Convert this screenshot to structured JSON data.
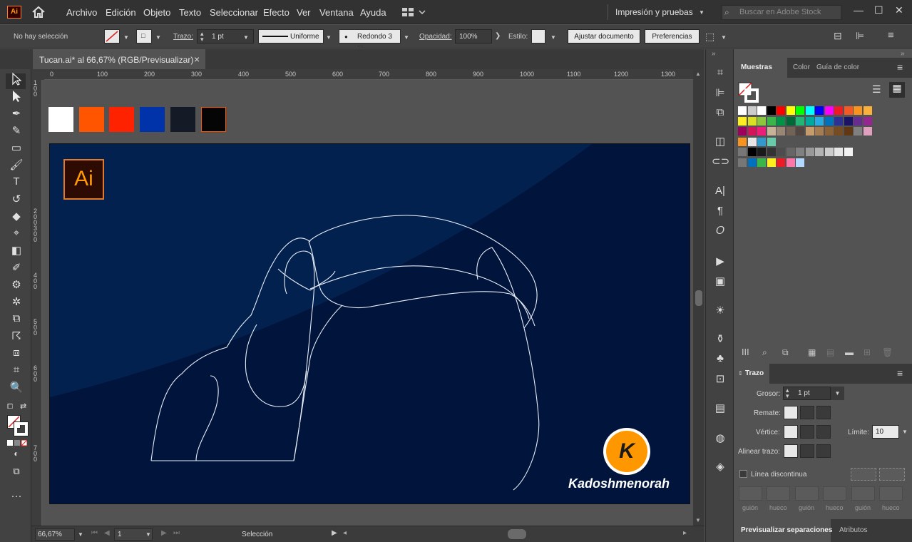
{
  "app": {
    "logo_text": "Ai",
    "menu": [
      "Archivo",
      "Edición",
      "Objeto",
      "Texto",
      "Seleccionar",
      "Efecto",
      "Ver",
      "Ventana",
      "Ayuda"
    ],
    "workspace": "Impresión y pruebas",
    "search_placeholder": "Buscar en Adobe Stock"
  },
  "control_bar": {
    "selection": "No hay selección",
    "stroke_label": "Trazo:",
    "stroke_weight": "1 pt",
    "profile": "Uniforme",
    "brush": "Redondo 3 ...",
    "opacity_label": "Opacidad:",
    "opacity": "100%",
    "style_label": "Estilo:",
    "adjust_btn": "Ajustar documento",
    "prefs_btn": "Preferencias"
  },
  "document": {
    "tab_title": "Tucan.ai* al 66,67% (RGB/Previsualizar)",
    "close": "×",
    "ruler_top": [
      "0",
      "100",
      "200",
      "300",
      "400",
      "500",
      "600",
      "700",
      "800",
      "900",
      "1000",
      "1100",
      "1200",
      "1300"
    ],
    "ruler_left": [
      "1\n0\n0",
      "2\n0\n0",
      "3\n0\n0",
      "4\n0\n0",
      "5\n0\n0",
      "6\n0\n0",
      "7\n0\n0"
    ],
    "artwork_logo": "Ai",
    "watermark_letter": "K",
    "watermark_text": "Kadoshmenorah",
    "colors": {
      "artboard": "#001a45",
      "swatch_row": [
        "#ffffff",
        "#ff5500",
        "#ff2200",
        "#0033aa",
        "#141b26",
        "#050505"
      ]
    }
  },
  "status_bar": {
    "zoom": "66,67%",
    "artboard_num": "1",
    "tool": "Selección"
  },
  "panels": {
    "swatches_tabs": [
      "Muestras",
      "Color",
      "Guía de color"
    ],
    "stroke": {
      "title": "Trazo",
      "weight_label": "Grosor:",
      "weight_value": "1 pt",
      "cap_label": "Remate:",
      "corner_label": "Vértice:",
      "limit_label": "Límite:",
      "limit_value": "10",
      "align_label": "Alinear trazo:",
      "dashed_label": "Línea discontinua",
      "dash_labels": [
        "guión",
        "hueco",
        "guión",
        "hueco",
        "guión",
        "hueco"
      ]
    },
    "bottom_tabs": [
      "Previsualizar separaciones",
      "Atributos"
    ]
  }
}
